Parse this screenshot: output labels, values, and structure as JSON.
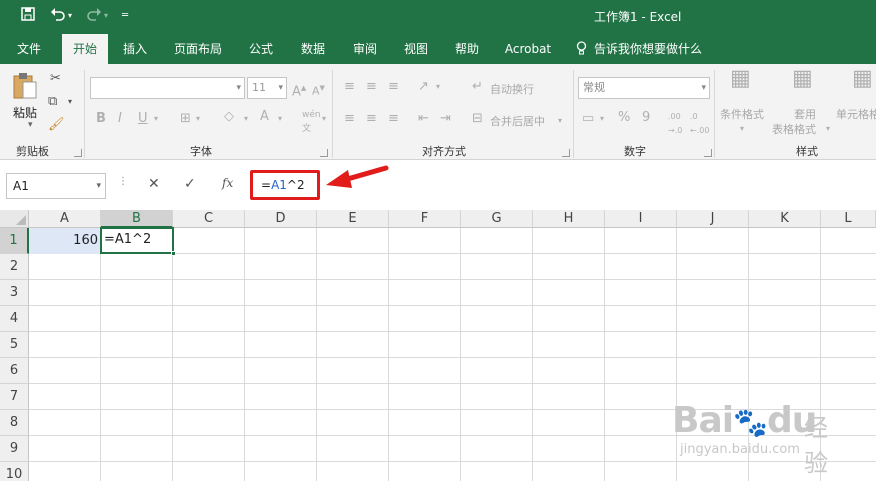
{
  "titlebar": {
    "title": "工作簿1  -  Excel",
    "undo_icon": "undo-icon",
    "redo_icon": "redo-icon"
  },
  "tabs": [
    "文件",
    "开始",
    "插入",
    "页面布局",
    "公式",
    "数据",
    "审阅",
    "视图",
    "帮助",
    "Acrobat",
    "告诉我你想要做什么"
  ],
  "ribbon": {
    "clipboard": {
      "paste": "粘贴",
      "label": "剪贴板"
    },
    "font": {
      "font_size": "11",
      "bold": "B",
      "italic": "I",
      "underline": "U",
      "label": "字体"
    },
    "alignment": {
      "wrap_text": "自动换行",
      "merge_center": "合并后居中",
      "label": "对齐方式"
    },
    "number": {
      "format": "常规",
      "percent": "%",
      "comma": "9",
      "label": "数字"
    },
    "styles": {
      "conditional": "条件格式",
      "table_format_1": "套用",
      "table_format_2": "表格格式",
      "cell_styles": "单元格格",
      "label": "样式"
    }
  },
  "formula_bar": {
    "name_box": "A1",
    "cancel": "✕",
    "enter": "✓",
    "fx": "fx",
    "formula_prefix": "=",
    "formula_ref": "A1",
    "formula_suffix": "^2"
  },
  "sheet": {
    "columns": [
      "A",
      "B",
      "C",
      "D",
      "E",
      "F",
      "G",
      "H",
      "I",
      "J",
      "K",
      "L"
    ],
    "rows": [
      "1",
      "2",
      "3",
      "4",
      "5",
      "6",
      "7",
      "8",
      "9",
      "10"
    ],
    "cells": {
      "A1": "160",
      "B1": "=A1^2"
    }
  },
  "watermark": {
    "logo": "Bai",
    "logo2": "du",
    "brand": "经验",
    "url": "jingyan.baidu.com"
  },
  "colors": {
    "excel_green": "#217346",
    "highlight_red": "#e21b1b",
    "ref_blue": "#2463c6"
  }
}
